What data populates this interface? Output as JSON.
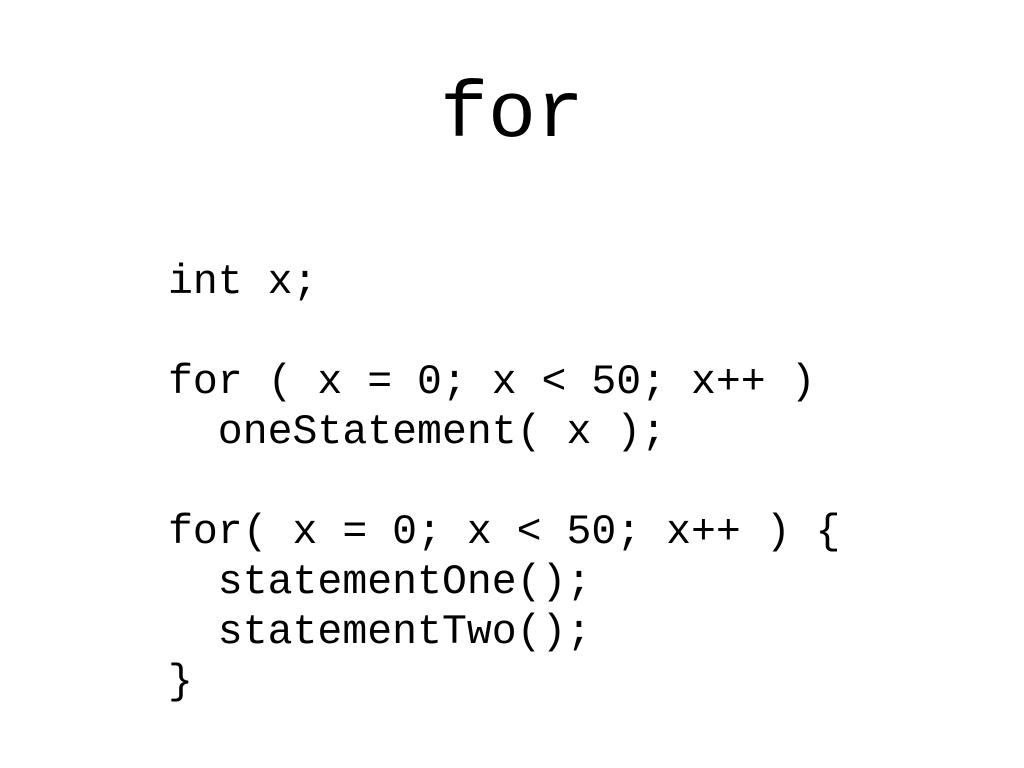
{
  "slide": {
    "title": "for",
    "code_lines": [
      "int x;",
      "for ( x = 0; x < 50; x++ )",
      "  oneStatement( x );",
      "for( x = 0; x < 50; x++ ) {",
      "  statementOne();",
      "  statementTwo();",
      "}"
    ]
  }
}
